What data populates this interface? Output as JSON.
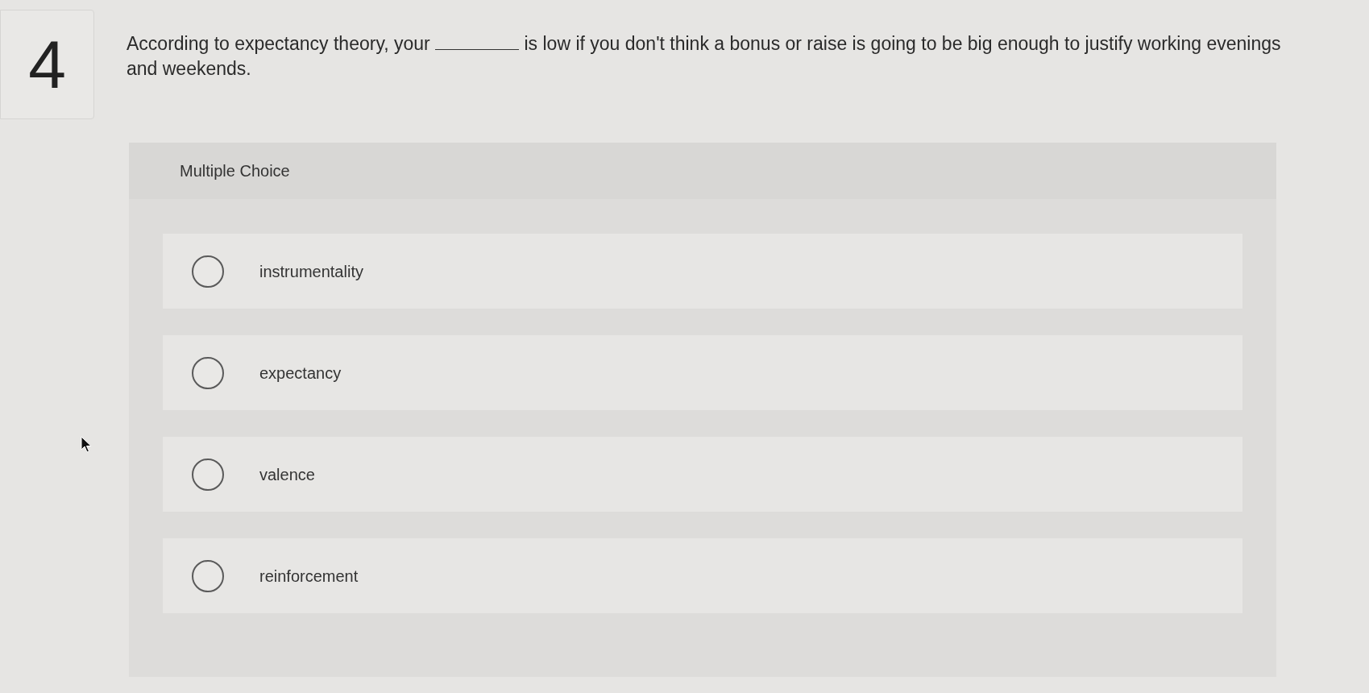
{
  "question": {
    "number": "4",
    "parts": [
      {
        "kind": "text",
        "text": "According to expectancy theory, your"
      },
      {
        "kind": "blank"
      },
      {
        "kind": "text",
        "text": "is low if you don't think a bonus or raise is going to be big enough to justify working evenings and weekends."
      }
    ]
  },
  "answer_panel": {
    "heading": "Multiple Choice",
    "options": [
      {
        "label": "instrumentality",
        "selected": false
      },
      {
        "label": "expectancy",
        "selected": false
      },
      {
        "label": "valence",
        "selected": false
      },
      {
        "label": "reinforcement",
        "selected": false
      }
    ]
  }
}
